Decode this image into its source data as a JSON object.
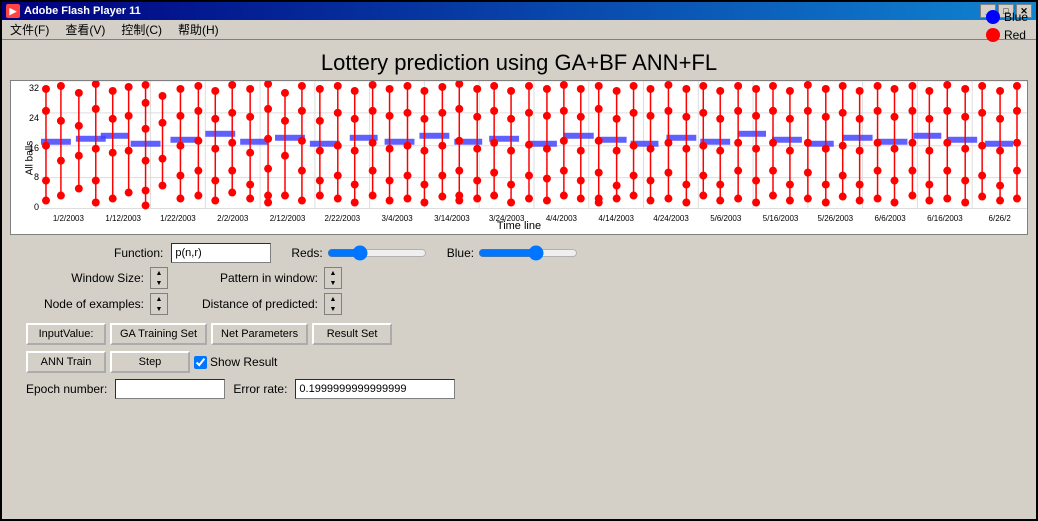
{
  "window": {
    "title": "Adobe Flash Player 11",
    "icon": "▶"
  },
  "menu": {
    "items": [
      "文件(F)",
      "查看(V)",
      "控制(C)",
      "帮助(H)"
    ]
  },
  "chart": {
    "title": "Lottery prediction using GA+BF ANN+FL",
    "legend": {
      "blue_label": "Blue",
      "red_label": "Red"
    },
    "y_axis_label": "All balls",
    "y_ticks": [
      "0",
      "8",
      "16",
      "24",
      "32"
    ],
    "x_labels": [
      "1/2/2003",
      "1/12/2003",
      "1/22/2003",
      "2/2/2003",
      "2/12/2003",
      "2/22/2003",
      "3/4/2003",
      "3/14/2003",
      "3/24/2003",
      "4/4/2003",
      "4/14/2003",
      "4/24/2003",
      "5/6/2003",
      "5/16/2003",
      "5/26/2003",
      "6/6/2003",
      "6/16/2003",
      "6/26/2"
    ],
    "x_axis_title": "Time line"
  },
  "controls": {
    "function_label": "Function:",
    "function_value": "p(n,r)",
    "reds_label": "Reds:",
    "blue_label": "Blue:",
    "params": [
      {
        "label": "Window Size:",
        "value": ""
      },
      {
        "label": "Pattern in window:",
        "value": ""
      },
      {
        "label": "Node of examples:",
        "value": ""
      },
      {
        "label": "Distance of predicted:",
        "value": ""
      }
    ],
    "buttons_row1": [
      "InputValue:",
      "GA Training Set",
      "Net Parameters",
      "Result Set"
    ],
    "buttons_row2": [
      "ANN Train",
      "Step"
    ],
    "show_result_label": "Show Result",
    "epoch_label": "Epoch number:",
    "epoch_value": "",
    "error_label": "Error rate:",
    "error_value": "0.1999999999999999"
  },
  "title_controls": {
    "minimize": "_",
    "maximize": "□",
    "close": "✕"
  }
}
